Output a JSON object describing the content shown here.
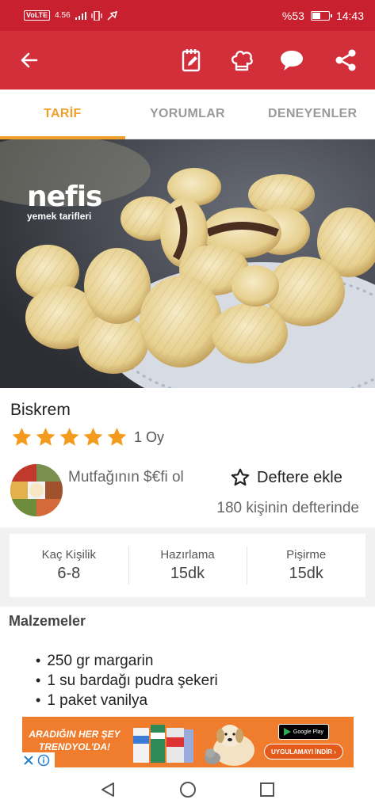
{
  "status_bar": {
    "network": "VoLTE",
    "speed": "4.56",
    "battery_percent": "%53",
    "battery_level": 0.53,
    "time": "14:43"
  },
  "app_bar": {
    "icons": [
      "back-arrow-icon",
      "notepad-edit-icon",
      "chef-hat-icon",
      "chat-bubble-icon",
      "share-icon"
    ]
  },
  "tabs": [
    {
      "label": "TARİF",
      "active": true
    },
    {
      "label": "YORUMLAR",
      "active": false
    },
    {
      "label": "DENEYENLER",
      "active": false
    }
  ],
  "hero": {
    "logo_word": "nefis",
    "logo_sub": "yemek tarifleri"
  },
  "recipe": {
    "title": "Biskrem",
    "stars": 5,
    "vote_count": "1 Oy"
  },
  "author": {
    "name": "Mutfağının $€fi ol"
  },
  "notebook": {
    "button_label": "Deftere ekle",
    "count_text": "180 kişinin defterinde"
  },
  "info": [
    {
      "label": "Kaç Kişilik",
      "value": "6-8"
    },
    {
      "label": "Hazırlama",
      "value": "15dk"
    },
    {
      "label": "Pişirme",
      "value": "15dk"
    }
  ],
  "ingredients": {
    "title": "Malzemeler",
    "items": [
      "250 gr margarin",
      "1 su bardağı pudra şekeri",
      "1 paket vanilya"
    ]
  },
  "ad": {
    "headline": "ARADIĞIN HER ŞEY TRENDYOL'DA!",
    "store_label": "Google Play",
    "cta": "UYGULAMAYI İNDİR ›",
    "colors": {
      "background": "#ef7d2d",
      "cta": "#e45a1b"
    }
  },
  "colors": {
    "status_bar": "#c9202f",
    "app_bar": "#d32f3a",
    "accent": "#f0a02a",
    "star": "#f39b1f"
  }
}
